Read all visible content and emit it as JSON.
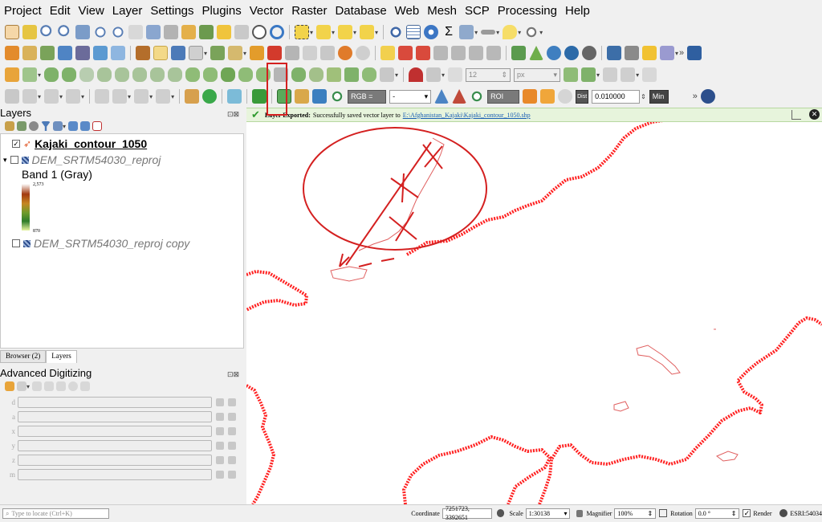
{
  "menu": [
    "Project",
    "Edit",
    "View",
    "Layer",
    "Settings",
    "Plugins",
    "Vector",
    "Raster",
    "Database",
    "Web",
    "Mesh",
    "SCP",
    "Processing",
    "Help"
  ],
  "digitizing_toolbar": {
    "unit_combo": "px",
    "more": "»"
  },
  "scp_toolbar": {
    "rgb_combo": "RGB =",
    "rgb_value": "-",
    "roi_label": "ROI",
    "dist_label": "Dist",
    "dist_value": "0.010000",
    "dist_mode": "Min",
    "more": "»"
  },
  "message": {
    "prefix": "Layer Exported:",
    "text": "Successfully saved vector layer to",
    "link": "E:\\Afghanistan_Kajaki\\Kajaki_contour_1050.shp"
  },
  "layers_panel": {
    "title": "Layers",
    "layers": [
      {
        "name": "Kajaki_contour_1050",
        "checked": true,
        "style": "bold-underline"
      },
      {
        "name": "DEM_SRTM54030_reproj",
        "checked": false,
        "style": "italic"
      },
      {
        "name": "DEM_SRTM54030_reproj copy",
        "checked": false,
        "style": "italic"
      }
    ],
    "band_label": "Band 1 (Gray)",
    "legend_max": "2,573",
    "legend_min": "870"
  },
  "tabs": [
    "Browser (2)",
    "Layers"
  ],
  "adv_digitizing": {
    "title": "Advanced Digitizing",
    "fields": [
      "d",
      "a",
      "x",
      "y",
      "z",
      "m"
    ]
  },
  "status": {
    "locator_placeholder": "Type to locate (Ctrl+K)",
    "coordinate_label": "Coordinate",
    "coordinate": "7251723, 3392651",
    "scale_label": "Scale",
    "scale": "1:30138",
    "magnifier_label": "Magnifier",
    "magnifier": "100%",
    "rotation_label": "Rotation",
    "rotation": "0.0 °",
    "render_label": "Render",
    "crs": "ESRI:54034"
  },
  "colors": {
    "contour": "#ff2020",
    "annotation": "#d42020",
    "message_bg": "#e7f4dc"
  }
}
